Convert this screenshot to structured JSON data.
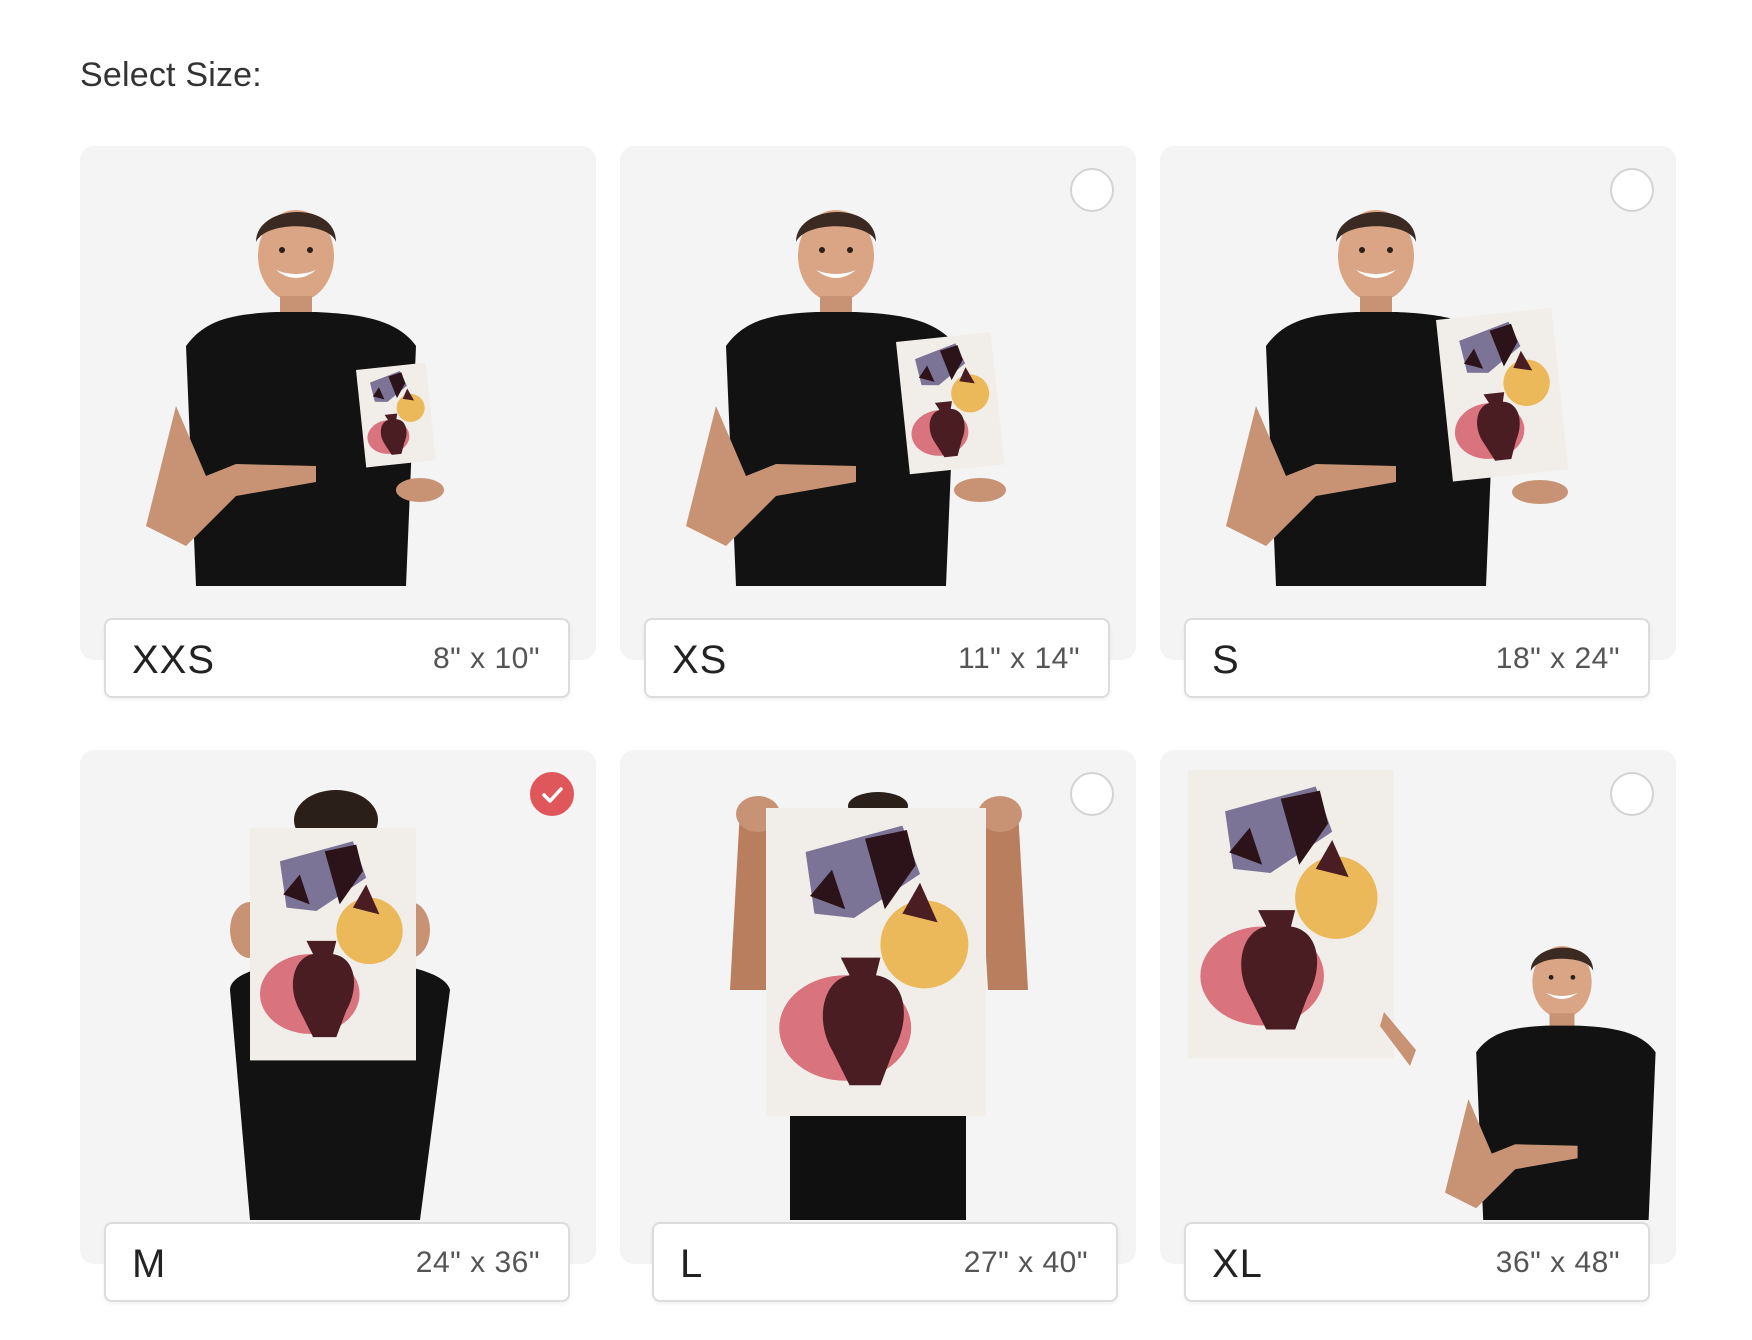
{
  "heading": "Select Size:",
  "colors": {
    "accent_selected": "#e0575b",
    "card_bg": "#f4f4f4",
    "radio_border": "#d3d3d3"
  },
  "options": [
    {
      "size": "XXS",
      "dimensions": "8\" x 10\"",
      "selected": false
    },
    {
      "size": "XS",
      "dimensions": "11\" x 14\"",
      "selected": false
    },
    {
      "size": "S",
      "dimensions": "18\" x 24\"",
      "selected": false
    },
    {
      "size": "M",
      "dimensions": "24\" x 36\"",
      "selected": true
    },
    {
      "size": "L",
      "dimensions": "27\" x 40\"",
      "selected": false
    },
    {
      "size": "XL",
      "dimensions": "36\" x 48\"",
      "selected": false
    }
  ],
  "icons": {
    "selected": "checkmark-icon",
    "unselected": "radio-circle-icon"
  }
}
